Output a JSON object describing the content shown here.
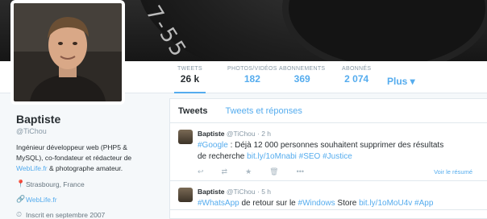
{
  "banner": {
    "lens_text": "7-55"
  },
  "nav": {
    "stats": [
      {
        "label": "TWEETS",
        "value": "26 k"
      },
      {
        "label": "PHOTOS/VIDÉOS",
        "value": "182"
      },
      {
        "label": "ABONNEMENTS",
        "value": "369"
      },
      {
        "label": "ABONNÉS",
        "value": "2 074"
      }
    ],
    "more": "Plus ▾"
  },
  "profile": {
    "name": "Baptiste",
    "handle": "@TiChou",
    "bio_1": "Ingénieur développeur web (PHP5 &",
    "bio_2": "MySQL), co-fondateur et rédacteur de",
    "bio_link": "WebLife.fr",
    "bio_3": " & photographe amateur.",
    "location": "Strasbourg, France",
    "website": "WebLife.fr",
    "joined": "Inscrit en septembre 2007"
  },
  "icons": {
    "location": "📍",
    "link": "🔗",
    "calendar": "⏲",
    "reply": "↩",
    "retweet": "⇄",
    "favorite": "★",
    "delete": "🗑",
    "more": "•••"
  },
  "timeline": {
    "tabs": [
      "Tweets",
      "Tweets et réponses"
    ],
    "tweets": [
      {
        "author": "Baptiste",
        "meta": "@TiChou · 2 h",
        "text_1": "#Google",
        "text_2": " : Déjà 12 000 personnes souhaitent supprimer des résultats",
        "text_3": "de recherche ",
        "text_4": "bit.ly/1oMnabi",
        "text_5": " ",
        "text_6": "#SEO",
        "text_7": " ",
        "text_8": "#Justice",
        "summary": "Voir le résumé"
      },
      {
        "author": "Baptiste",
        "meta": "@TiChou · 5 h",
        "text_1": "#WhatsApp",
        "text_2": " de retour sur le ",
        "text_3": "#Windows",
        "text_4": " Store ",
        "text_5": "bit.ly/1oMoU4v",
        "text_6": " ",
        "text_7": "#App"
      }
    ]
  },
  "colors": {
    "accent": "#55acee",
    "text": "#292f33",
    "muted": "#8899a6",
    "background": "#f5f8fa"
  }
}
